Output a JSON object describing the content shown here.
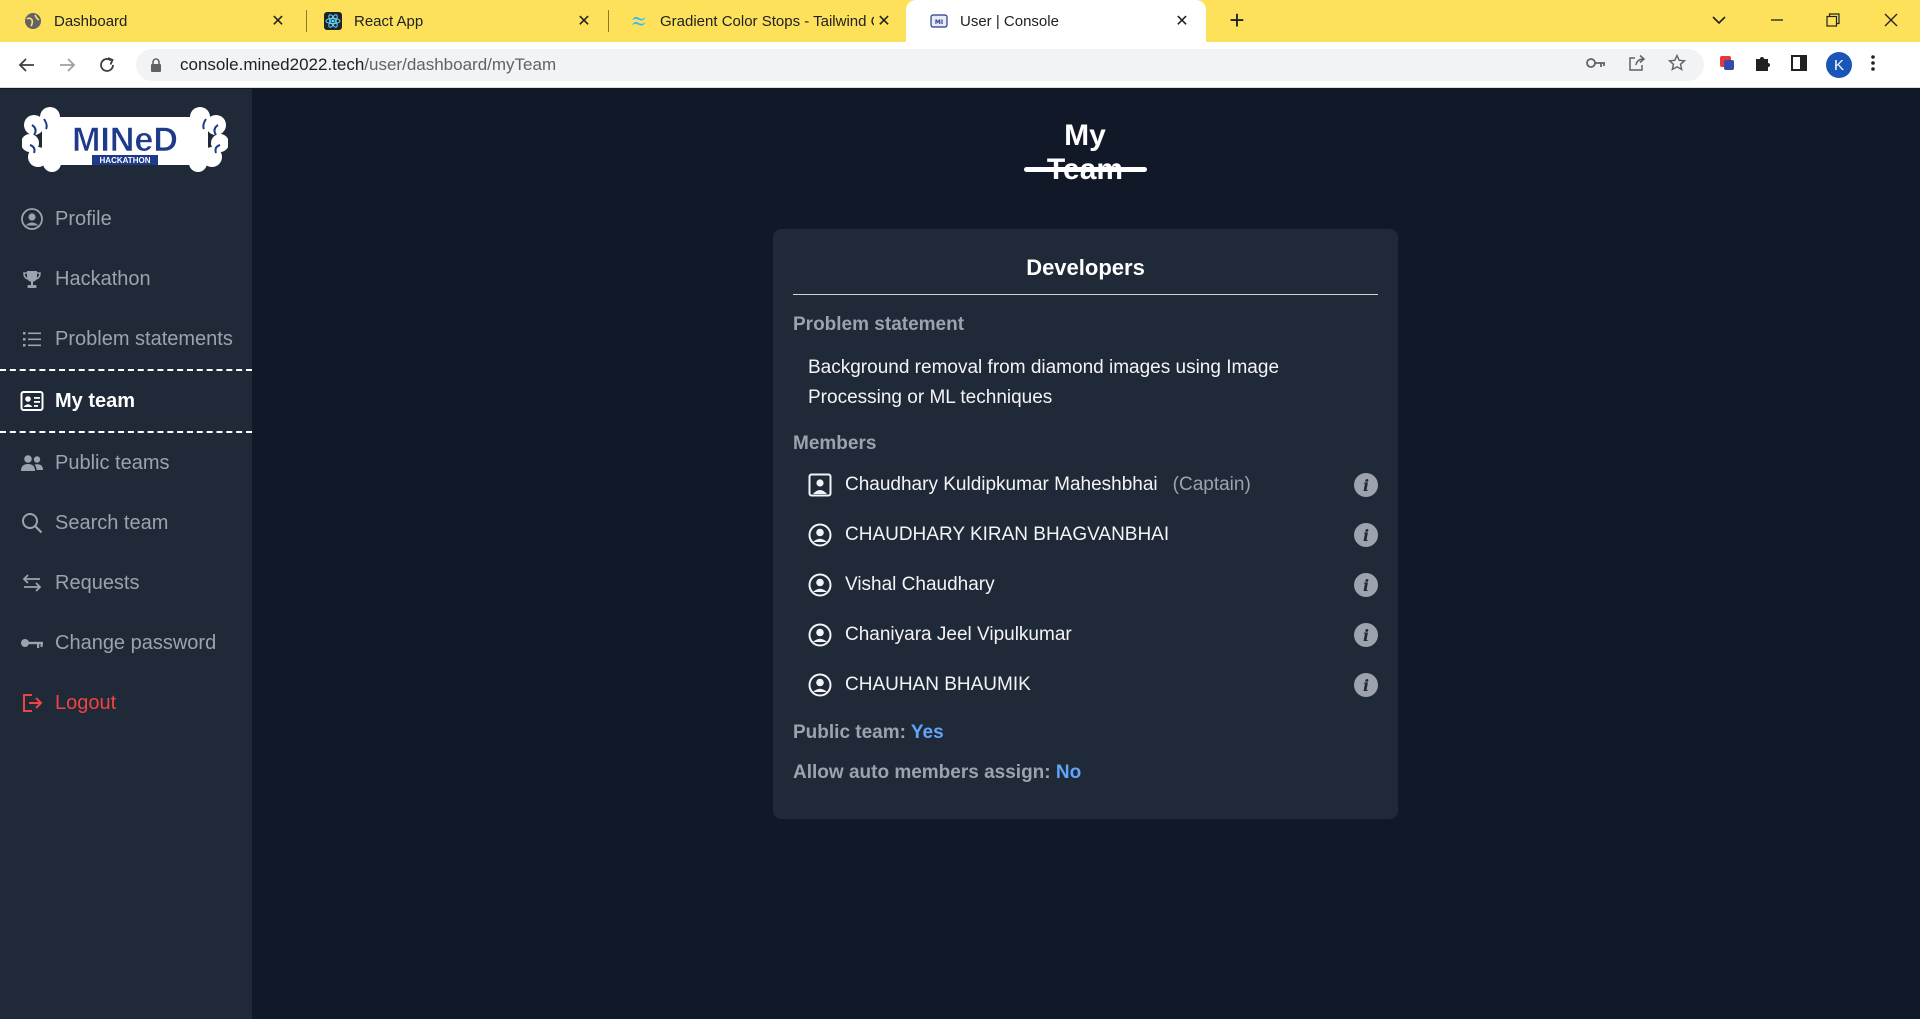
{
  "browser": {
    "tabs": [
      {
        "title": "Dashboard",
        "icon": "globe-icon"
      },
      {
        "title": "React App",
        "icon": "react-icon"
      },
      {
        "title": "Gradient Color Stops - Tailwind C",
        "icon": "tailwind-icon"
      },
      {
        "title": "User | Console",
        "icon": "mined-icon",
        "active": true
      }
    ],
    "url_host": "console.mined2022.tech",
    "url_path": "/user/dashboard/myTeam",
    "profile_initial": "K",
    "tabstrip_color": "#fde15a"
  },
  "sidebar": {
    "logo_text": "MINeD",
    "logo_sub": "HACKATHON",
    "items": [
      {
        "label": "Profile",
        "icon": "user-circle-icon"
      },
      {
        "label": "Hackathon",
        "icon": "trophy-icon"
      },
      {
        "label": "Problem statements",
        "icon": "list-icon"
      },
      {
        "label": "My team",
        "icon": "id-card-icon",
        "active": true
      },
      {
        "label": "Public teams",
        "icon": "users-icon"
      },
      {
        "label": "Search team",
        "icon": "search-icon"
      },
      {
        "label": "Requests",
        "icon": "arrows-exchange-icon"
      },
      {
        "label": "Change password",
        "icon": "key-icon"
      },
      {
        "label": "Logout",
        "icon": "logout-icon"
      }
    ]
  },
  "main": {
    "title": "My Team",
    "team": {
      "name": "Developers",
      "problem_label": "Problem statement",
      "problem_text": "Background removal from diamond images using Image Processing or ML techniques",
      "members_label": "Members",
      "members": [
        {
          "name": "Chaudhary Kuldipkumar Maheshbhai",
          "role": "(Captain)",
          "icon": "captain-icon"
        },
        {
          "name": "CHAUDHARY KIRAN BHAGVANBHAI",
          "role": "",
          "icon": "user-circle-icon"
        },
        {
          "name": "Vishal Chaudhary",
          "role": "",
          "icon": "user-circle-icon"
        },
        {
          "name": "Chaniyara Jeel Vipulkumar",
          "role": "",
          "icon": "user-circle-icon"
        },
        {
          "name": "CHAUHAN BHAUMIK",
          "role": "",
          "icon": "user-circle-icon"
        }
      ],
      "public_label": "Public team:",
      "public_value": "Yes",
      "auto_label": "Allow auto members assign:",
      "auto_value": "No"
    }
  },
  "colors": {
    "page_bg": "#111827",
    "panel_bg": "#1f2937",
    "accent_blue": "#60a5fa",
    "logout_red": "#ef4444"
  }
}
